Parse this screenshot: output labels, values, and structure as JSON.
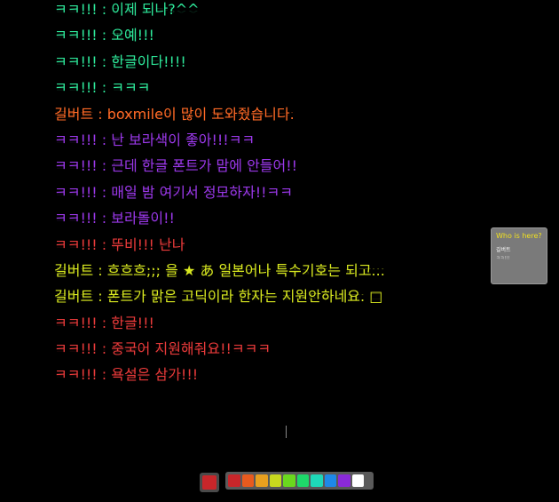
{
  "messages": [
    {
      "text": "ㅋㅋ!!! : 이제 되나?^^",
      "color": "#2ee89a"
    },
    {
      "text": "ㅋㅋ!!! : 오예!!!",
      "color": "#2ee89a"
    },
    {
      "text": "ㅋㅋ!!! : 한글이다!!!!",
      "color": "#2ee89a"
    },
    {
      "text": "ㅋㅋ!!! : ㅋㅋㅋ",
      "color": "#2ee89a"
    },
    {
      "text": "길버트 : boxmile이 많이 도와줬습니다.",
      "color": "#ff6a26"
    },
    {
      "text": "ㅋㅋ!!! : 난 보라색이 좋아!!!ㅋㅋ",
      "color": "#9a38e8"
    },
    {
      "text": "ㅋㅋ!!! : 근데 한글 폰트가 맘에 안들어!!",
      "color": "#9a38e8"
    },
    {
      "text": "ㅋㅋ!!! : 매일 밤 여기서 정모하자!!ㅋㅋ",
      "color": "#9a38e8"
    },
    {
      "text": "ㅋㅋ!!! : 보라돌이!!",
      "color": "#9a38e8"
    },
    {
      "text": "ㅋㅋ!!! : 뚜비!!! 난나",
      "color": "#e83a3a"
    },
    {
      "text": "길버트 : 흐흐흐;;; 을 ★ あ 일본어나 특수기호는 되고...",
      "color": "#d8e820"
    },
    {
      "text": "길버트 : 폰트가 맑은 고딕이라 한자는 지원안하네요. □",
      "color": "#d8e820"
    },
    {
      "text": "ㅋㅋ!!! : 한글!!!",
      "color": "#e83a3a"
    },
    {
      "text": "ㅋㅋ!!! : 중국어 지원해줘요!!ㅋㅋㅋ",
      "color": "#e83a3a"
    },
    {
      "text": "ㅋㅋ!!! : 욕설은 삼가!!!",
      "color": "#e83a3a"
    }
  ],
  "who_panel": {
    "title": "Who is here?",
    "users": [
      "길버트",
      "ㅋㅋ!!!"
    ],
    "title_color": "#f0e020"
  },
  "current_color": "#c8262a",
  "palette": [
    "#c8262a",
    "#e85a1e",
    "#e8a01e",
    "#c8d81e",
    "#6ad81e",
    "#1ed86a",
    "#1ed8b8",
    "#1e88e8",
    "#8a2ad8",
    "#ffffff"
  ]
}
